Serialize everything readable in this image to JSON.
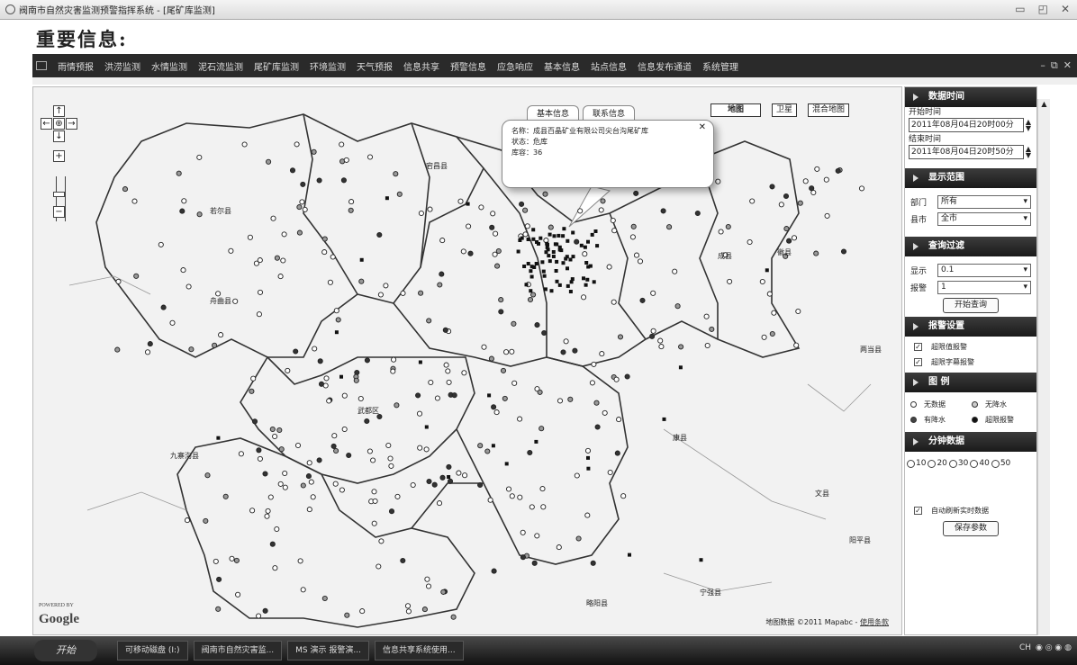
{
  "window": {
    "title": "阀南市自然灾害监测预警指挥系统 - [尾矿库监测]"
  },
  "headline": "重要信息:",
  "menu": [
    "雨情预报",
    "洪涝监测",
    "水情监测",
    "泥石流监测",
    "尾矿库监测",
    "环境监测",
    "天气预报",
    "信息共享",
    "预警信息",
    "应急响应",
    "基本信息",
    "站点信息",
    "信息发布通道",
    "系统管理"
  ],
  "map": {
    "map_types": [
      "地图",
      "卫星",
      "混合地图"
    ],
    "popup": {
      "tabs": [
        "基本信息",
        "联系信息"
      ],
      "lines": [
        "名称：成县百晶矿业有限公司尖台沟尾矿库",
        "状态：危库",
        "库容：36"
      ]
    },
    "cities": [
      "若尔县",
      "舟曲县",
      "宕昌县",
      "成县",
      "徽县",
      "两当县",
      "康县",
      "武都区",
      "文县",
      "九寨沟县",
      "阳平县",
      "宁强县",
      "略阳县"
    ],
    "google_powered": "POWERED BY",
    "google": "Google",
    "attribution": "地图数据 ©2011 Mapabc -",
    "terms": "使用条款"
  },
  "panel": {
    "data_time": {
      "header": "数据时间",
      "start_label": "开始时间",
      "start_value": "2011年08月04日20时00分",
      "end_label": "结束时间",
      "end_value": "2011年08月04日20时50分"
    },
    "range": {
      "header": "显示范围",
      "dept_label": "部门",
      "dept_value": "所有",
      "city_label": "县市",
      "city_value": "全市"
    },
    "filter": {
      "header": "查询过滤",
      "show_label": "显示",
      "show_value": "0.1",
      "alarm_label": "报警",
      "alarm_value": "1",
      "query_button": "开始查询"
    },
    "alarm_settings": {
      "header": "报警设置",
      "options": [
        "超限值报警",
        "超限字幕报警"
      ]
    },
    "legend": {
      "header": "图 例",
      "items": [
        "无数据",
        "无降水",
        "有降水",
        "超限报警"
      ]
    },
    "minute": {
      "header": "分钟数据",
      "options": [
        "10",
        "20",
        "30",
        "40",
        "50"
      ],
      "auto_refresh": "自动刷新实时数据",
      "save_button": "保存参数"
    }
  },
  "taskbar": {
    "start": "开始",
    "items": [
      "可移动磁盘 (I:)",
      "阀南市自然灾害监...",
      "MS 演示 报警演...",
      "信息共享系统使用..."
    ],
    "tray": "CH"
  }
}
